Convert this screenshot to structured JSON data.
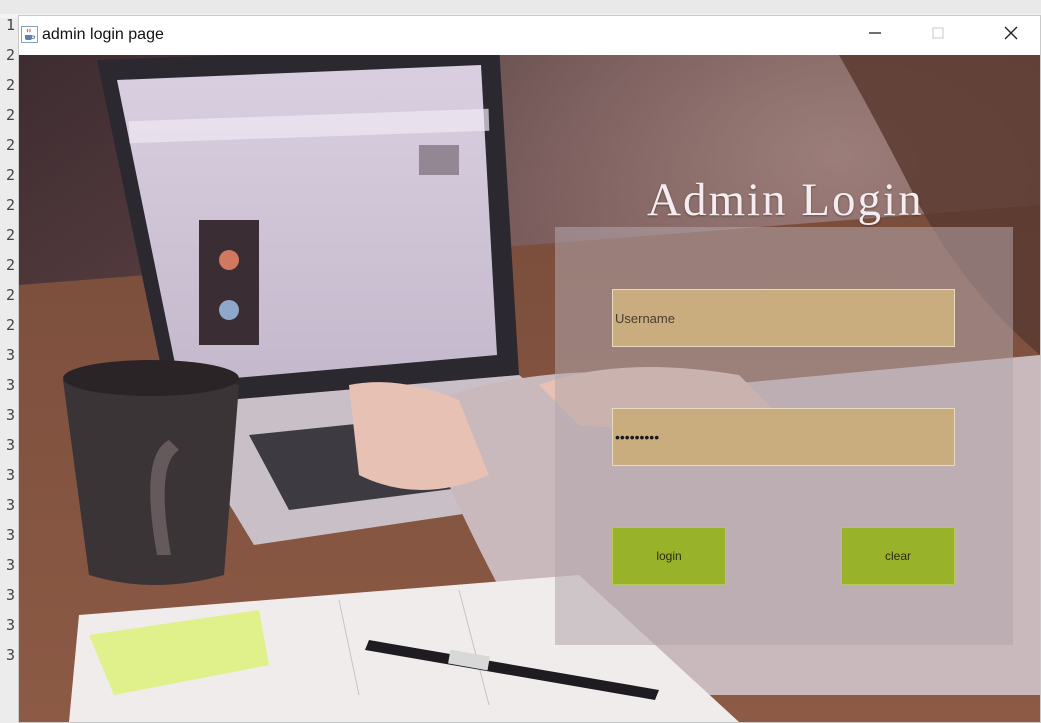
{
  "window": {
    "title": "admin login page"
  },
  "gutter": {
    "line_numbers": [
      "1",
      "2",
      "2",
      "2",
      "2",
      "2",
      "2",
      "2",
      "2",
      "2",
      "2",
      "3",
      "3",
      "3",
      "3",
      "3",
      "3",
      "3",
      "3",
      "3",
      "3",
      "3"
    ]
  },
  "form": {
    "heading": "Admin Login",
    "username_placeholder": "Username",
    "password_value": "•••••••••",
    "login_label": "login",
    "clear_label": "clear"
  },
  "colors": {
    "field_bg": "#c9ad7e",
    "button_bg": "#98b22a",
    "panel_overlay": "#b2a5ac"
  },
  "icons": {
    "app": "java-cup-icon",
    "minimize": "minimize-icon",
    "maximize": "maximize-icon",
    "close": "close-icon"
  }
}
